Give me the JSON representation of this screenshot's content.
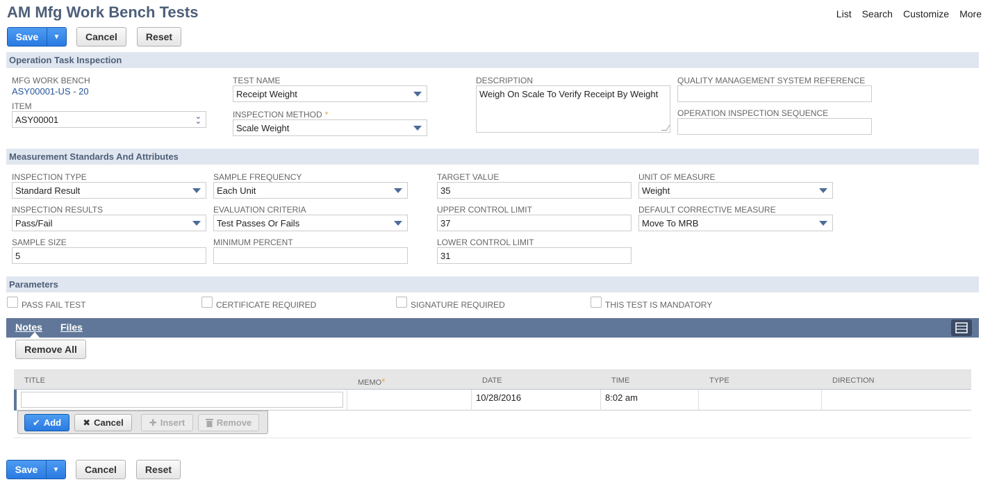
{
  "page": {
    "title": "AM Mfg Work Bench Tests"
  },
  "nav": {
    "list": "List",
    "search": "Search",
    "customize": "Customize",
    "more": "More"
  },
  "buttons": {
    "save": "Save",
    "cancel": "Cancel",
    "reset": "Reset"
  },
  "sections": {
    "operation": "Operation Task Inspection",
    "measurement": "Measurement Standards And Attributes",
    "parameters": "Parameters"
  },
  "operation": {
    "mfg_work_bench": {
      "label": "MFG WORK BENCH",
      "value": "ASY00001-US - 20"
    },
    "item": {
      "label": "ITEM",
      "value": "ASY00001"
    },
    "test_name": {
      "label": "TEST NAME",
      "value": "Receipt Weight"
    },
    "inspection_method": {
      "label": "INSPECTION METHOD",
      "value": "Scale Weight",
      "required": "*"
    },
    "description": {
      "label": "DESCRIPTION",
      "value": "Weigh On Scale To Verify Receipt By Weight"
    },
    "qms_reference": {
      "label": "QUALITY MANAGEMENT SYSTEM REFERENCE",
      "value": ""
    },
    "op_inspection_sequence": {
      "label": "OPERATION INSPECTION SEQUENCE",
      "value": ""
    }
  },
  "measurement": {
    "inspection_type": {
      "label": "INSPECTION TYPE",
      "value": "Standard Result"
    },
    "inspection_results": {
      "label": "INSPECTION RESULTS",
      "value": "Pass/Fail"
    },
    "sample_size": {
      "label": "SAMPLE SIZE",
      "value": "5"
    },
    "sample_frequency": {
      "label": "SAMPLE FREQUENCY",
      "value": "Each Unit"
    },
    "evaluation_criteria": {
      "label": "EVALUATION CRITERIA",
      "value": "Test Passes Or Fails"
    },
    "minimum_percent": {
      "label": "MINIMUM PERCENT",
      "value": ""
    },
    "target_value": {
      "label": "TARGET VALUE",
      "value": "35"
    },
    "upper_control_limit": {
      "label": "UPPER CONTROL LIMIT",
      "value": "37"
    },
    "lower_control_limit": {
      "label": "LOWER CONTROL LIMIT",
      "value": "31"
    },
    "unit_of_measure": {
      "label": "UNIT OF MEASURE",
      "value": "Weight"
    },
    "default_corrective_measure": {
      "label": "DEFAULT CORRECTIVE MEASURE",
      "value": "Move To MRB"
    }
  },
  "parameters": {
    "pass_fail_test": "PASS FAIL TEST",
    "certificate_required": "CERTIFICATE REQUIRED",
    "signature_required": "SIGNATURE REQUIRED",
    "mandatory": "THIS TEST IS MANDATORY"
  },
  "subtabs": {
    "notes": "Notes",
    "files": "Files"
  },
  "notes": {
    "remove_all": "Remove All",
    "columns": {
      "title": "TITLE",
      "memo": "MEMO",
      "memo_req": "*",
      "date": "DATE",
      "time": "TIME",
      "type": "TYPE",
      "direction": "DIRECTION"
    },
    "row": {
      "title": "",
      "memo": "",
      "date": "10/28/2016",
      "time": "8:02 am",
      "type": "",
      "direction": ""
    },
    "actions": {
      "add": "Add",
      "cancel": "Cancel",
      "insert": "Insert",
      "remove": "Remove"
    }
  },
  "colors": {
    "accent": "#2a7ae2",
    "section_bg": "#e0e6ef",
    "section_text": "#4d5f79",
    "subtab_bg": "#607799",
    "required": "#e8a33d",
    "link": "#255599"
  }
}
